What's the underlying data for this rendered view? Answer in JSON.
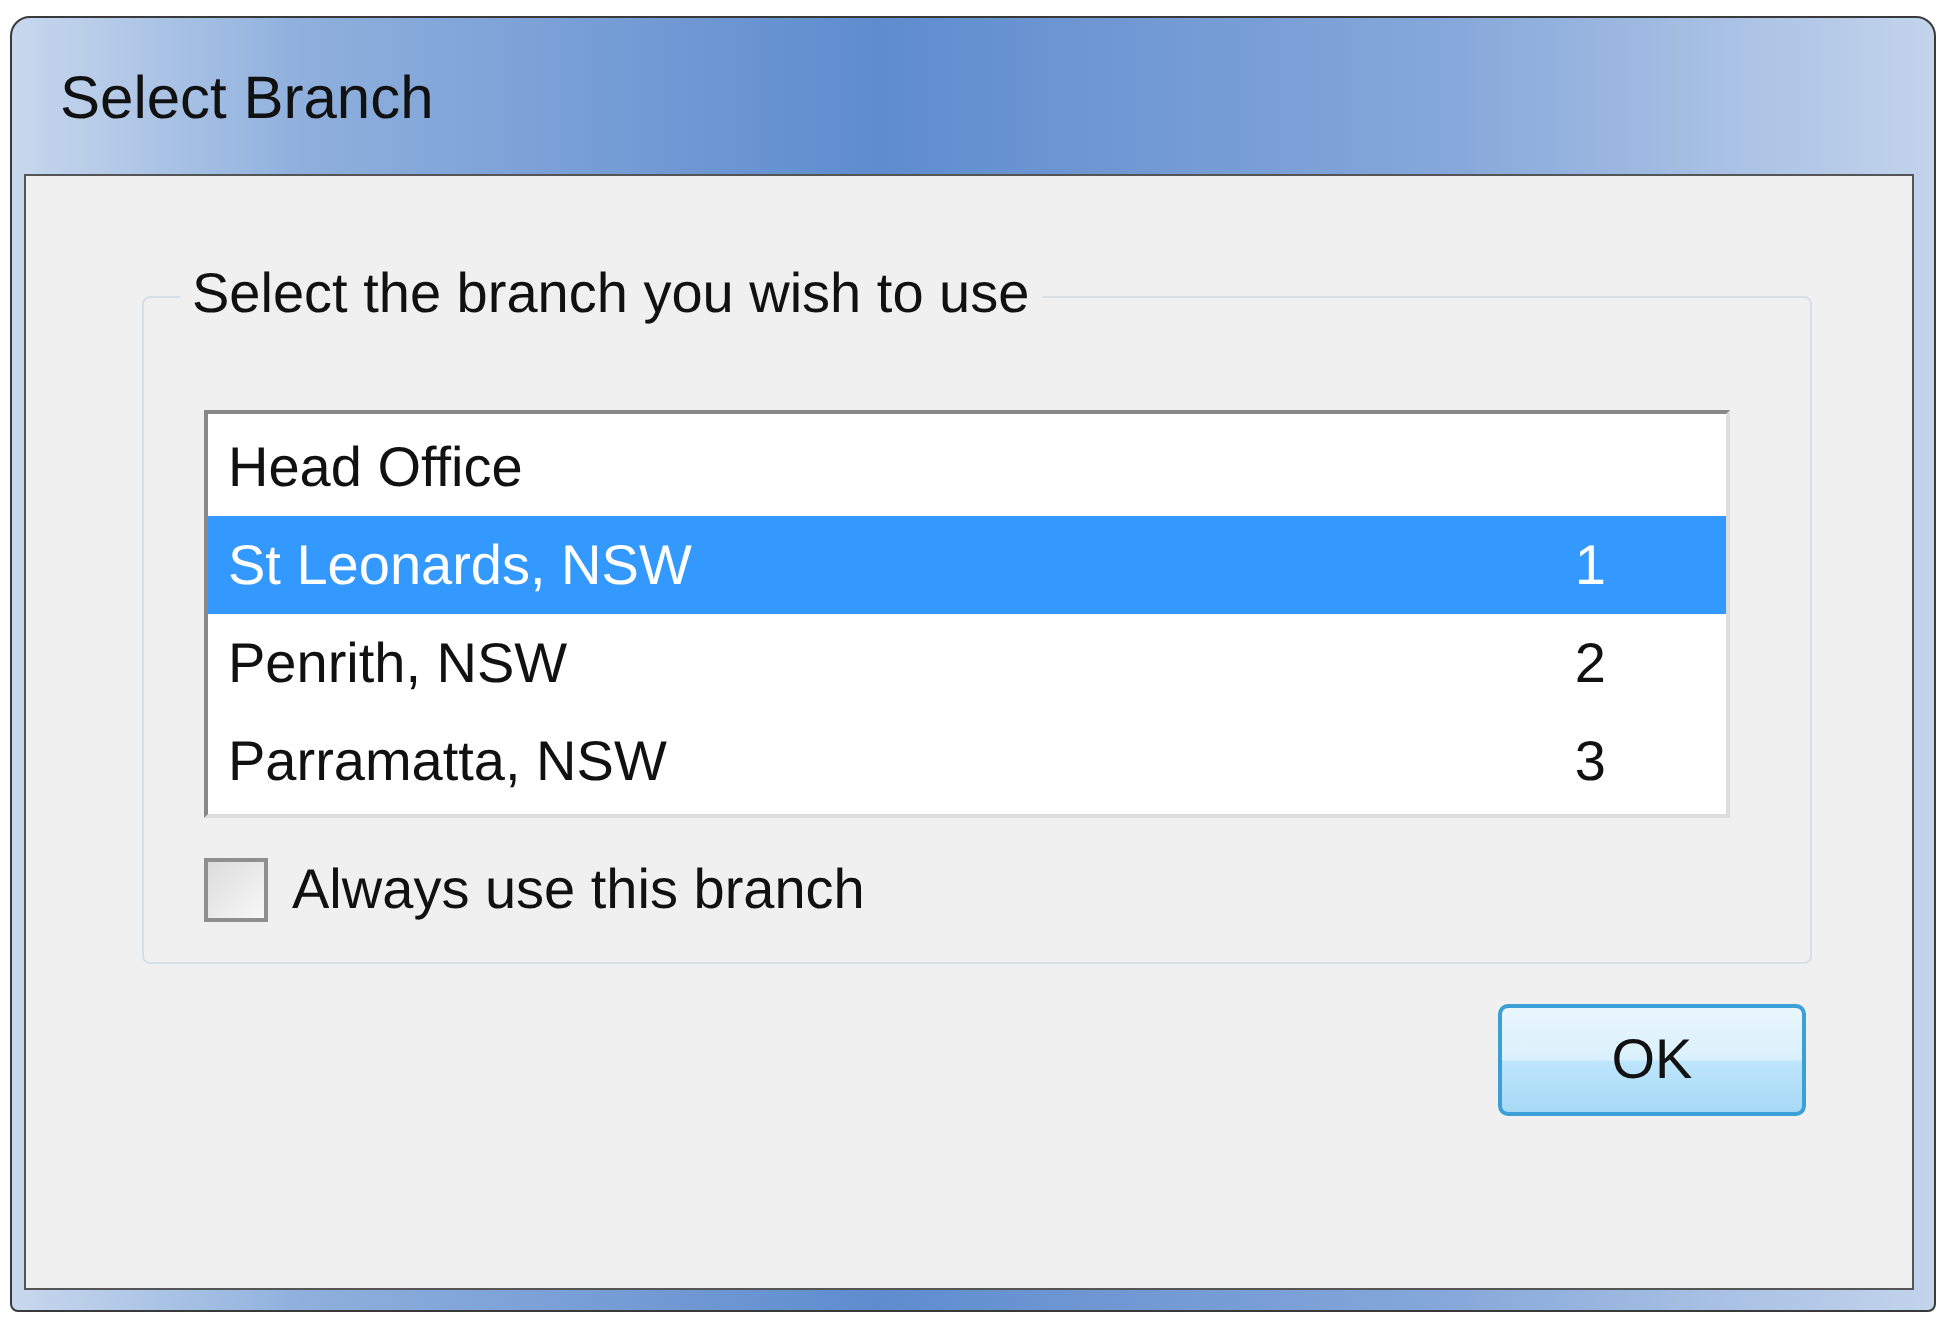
{
  "window": {
    "title": "Select Branch"
  },
  "group": {
    "label": "Select the branch you wish to use"
  },
  "branches": [
    {
      "name": "Head Office",
      "selected": false
    },
    {
      "name": "St Leonards, NSW",
      "number": "1",
      "selected": true
    },
    {
      "name": "Penrith, NSW",
      "number": "2",
      "selected": false
    },
    {
      "name": "Parramatta, NSW",
      "number": "3",
      "selected": false
    }
  ],
  "always_use": {
    "label": "Always use this branch",
    "checked": false
  },
  "buttons": [
    "OK"
  ]
}
